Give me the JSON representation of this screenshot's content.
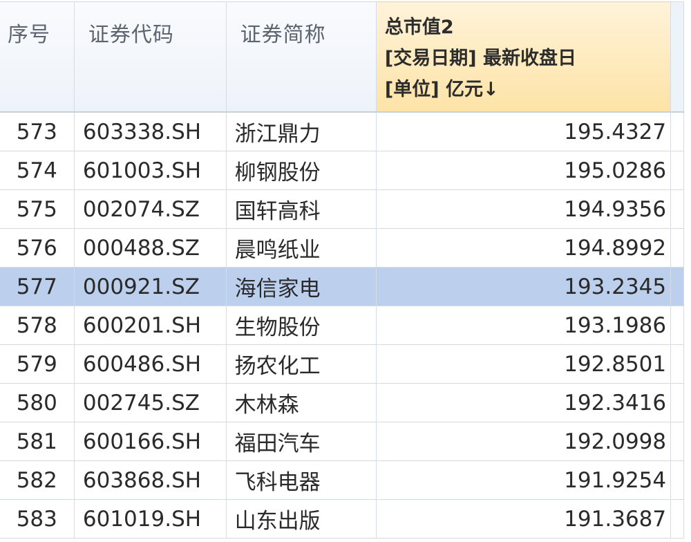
{
  "table": {
    "columns": [
      {
        "key": "idx",
        "label": "序号"
      },
      {
        "key": "code",
        "label": "证券代码"
      },
      {
        "key": "name",
        "label": "证券简称"
      },
      {
        "key": "mv",
        "label_lines": [
          "总市值2",
          "[交易日期] 最新收盘日",
          "[单位] 亿元↓"
        ]
      }
    ],
    "rows": [
      {
        "idx": "573",
        "code": "603338.SH",
        "name": "浙江鼎力",
        "mv": "195.4327",
        "selected": false
      },
      {
        "idx": "574",
        "code": "601003.SH",
        "name": "柳钢股份",
        "mv": "195.0286",
        "selected": false
      },
      {
        "idx": "575",
        "code": "002074.SZ",
        "name": "国轩高科",
        "mv": "194.9356",
        "selected": false
      },
      {
        "idx": "576",
        "code": "000488.SZ",
        "name": "晨鸣纸业",
        "mv": "194.8992",
        "selected": false
      },
      {
        "idx": "577",
        "code": "000921.SZ",
        "name": "海信家电",
        "mv": "193.2345",
        "selected": true
      },
      {
        "idx": "578",
        "code": "600201.SH",
        "name": "生物股份",
        "mv": "193.1986",
        "selected": false
      },
      {
        "idx": "579",
        "code": "600486.SH",
        "name": "扬农化工",
        "mv": "192.8501",
        "selected": false
      },
      {
        "idx": "580",
        "code": "002745.SZ",
        "name": "木林森",
        "mv": "192.3416",
        "selected": false
      },
      {
        "idx": "581",
        "code": "600166.SH",
        "name": "福田汽车",
        "mv": "192.0998",
        "selected": false
      },
      {
        "idx": "582",
        "code": "603868.SH",
        "name": "飞科电器",
        "mv": "191.9254",
        "selected": false
      },
      {
        "idx": "583",
        "code": "601019.SH",
        "name": "山东出版",
        "mv": "191.3687",
        "selected": false
      }
    ]
  },
  "colors": {
    "header_bg": "#eef3f9",
    "sorted_header_bg": "#fde3a6",
    "selected_row_bg": "#bcd0ee",
    "grid_line": "#d4dbe6"
  }
}
